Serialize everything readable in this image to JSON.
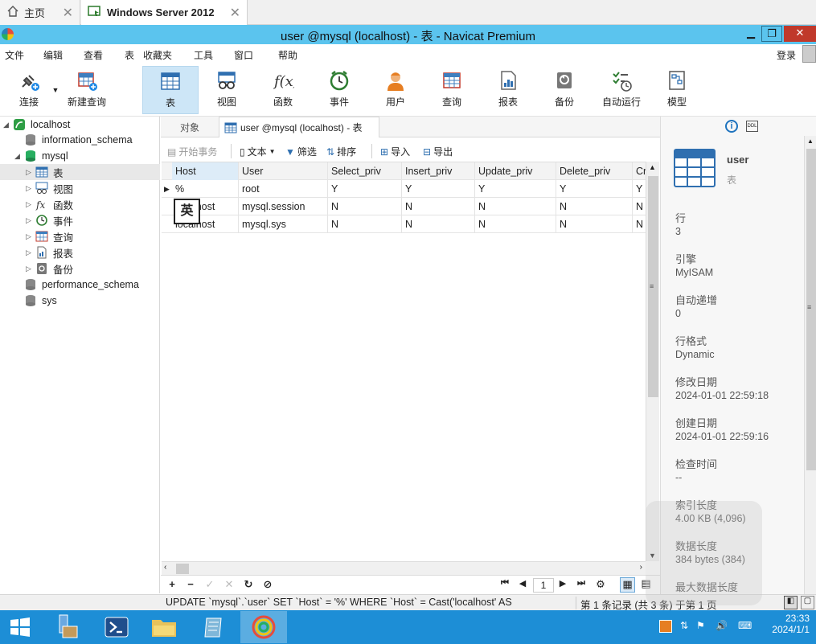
{
  "host_tabs": {
    "home": "主页",
    "active": "Windows Server 2012"
  },
  "window": {
    "title": "user @mysql (localhost) - 表 - Navicat Premium"
  },
  "menu": [
    "文件",
    "编辑",
    "查看",
    "表",
    "收藏夹",
    "工具",
    "窗口",
    "帮助"
  ],
  "login": "登录",
  "toolbar": [
    "连接",
    "新建查询",
    "表",
    "视图",
    "函数",
    "事件",
    "用户",
    "查询",
    "报表",
    "备份",
    "自动运行",
    "模型"
  ],
  "tree": {
    "connection": "localhost",
    "databases": [
      "information_schema",
      "mysql",
      "performance_schema",
      "sys"
    ],
    "mysql_children": [
      "表",
      "视图",
      "函数",
      "事件",
      "查询",
      "报表",
      "备份"
    ]
  },
  "center_tabs": {
    "objects": "对象",
    "active": "user @mysql (localhost) - 表"
  },
  "subtoolbar": [
    "开始事务",
    "文本",
    "筛选",
    "排序",
    "导入",
    "导出"
  ],
  "grid": {
    "columns": [
      "Host",
      "User",
      "Select_priv",
      "Insert_priv",
      "Update_priv",
      "Delete_priv",
      "Cr"
    ],
    "rows": [
      [
        "%",
        "root",
        "Y",
        "Y",
        "Y",
        "Y",
        "Y"
      ],
      [
        "localhost",
        "mysql.session",
        "N",
        "N",
        "N",
        "N",
        "N"
      ],
      [
        "localhost",
        "mysql.sys",
        "N",
        "N",
        "N",
        "N",
        "N"
      ]
    ],
    "ime_overlay": "英"
  },
  "pager": {
    "page": "1"
  },
  "status": {
    "sql": "UPDATE `mysql`.`user` SET `Host` = '%' WHERE `Host` = Cast('localhost' AS",
    "records": "第 1 条记录 (共 3 条) 于第 1 页"
  },
  "info_panel": {
    "name": "user",
    "type": "表",
    "fields": [
      {
        "label": "行",
        "value": "3"
      },
      {
        "label": "引擎",
        "value": "MyISAM"
      },
      {
        "label": "自动递增",
        "value": "0"
      },
      {
        "label": "行格式",
        "value": "Dynamic"
      },
      {
        "label": "修改日期",
        "value": "2024-01-01 22:59:18"
      },
      {
        "label": "创建日期",
        "value": "2024-01-01 22:59:16"
      },
      {
        "label": "检查时间",
        "value": "--"
      },
      {
        "label": "索引长度",
        "value": "4.00 KB (4,096)"
      },
      {
        "label": "数据长度",
        "value": "384 bytes (384)"
      },
      {
        "label": "最大数据长度",
        "value": ""
      }
    ]
  },
  "taskbar": {
    "time": "23:33",
    "date": "2024/1/1"
  }
}
